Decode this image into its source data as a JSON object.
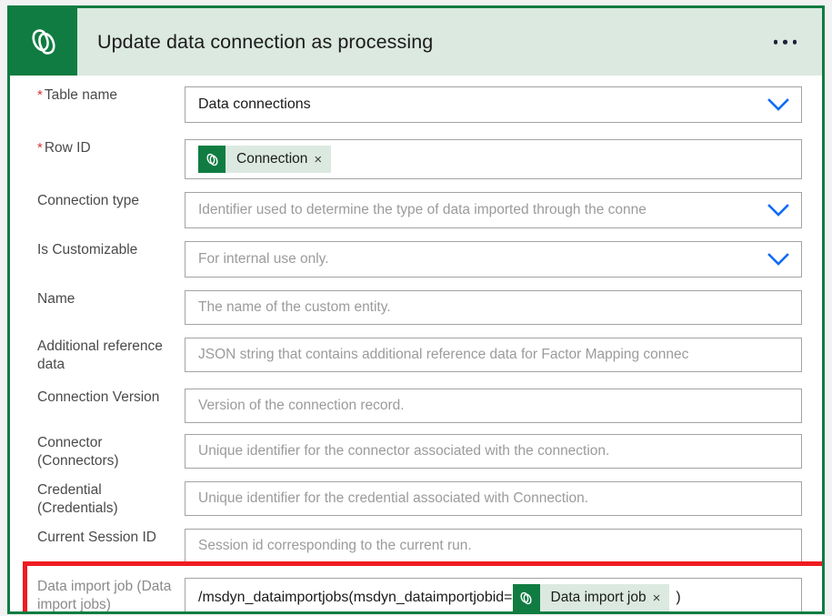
{
  "header": {
    "title": "Update data connection as processing",
    "icon": "dataverse-icon",
    "overflow_label": "...",
    "background_color": "#dbe9e0",
    "icon_tile_color": "#107c41"
  },
  "colors": {
    "accent_green": "#107c41",
    "chip_background": "#dbe9e0",
    "required_red": "#d13438",
    "highlight_red": "#ee1c21",
    "chevron_blue": "#0f6cf5"
  },
  "fields": [
    {
      "label": "Table name",
      "required": true,
      "value": "Data connections",
      "has_dropdown": true
    },
    {
      "label": "Row ID",
      "required": true,
      "token": {
        "label": "Connection",
        "icon": "dataverse-icon",
        "close": "×"
      },
      "has_dropdown": false
    },
    {
      "label": "Connection type",
      "required": false,
      "placeholder": "Identifier used to determine the type of data imported through the conne",
      "has_dropdown": true
    },
    {
      "label": "Is Customizable",
      "required": false,
      "placeholder": "For internal use only.",
      "has_dropdown": true
    },
    {
      "label": "Name",
      "required": false,
      "placeholder": "The name of the custom entity.",
      "has_dropdown": false
    },
    {
      "label": "Additional reference\ndata",
      "required": false,
      "placeholder": "JSON string that contains additional reference data for Factor Mapping connec",
      "has_dropdown": false
    },
    {
      "label": "Connection Version",
      "required": false,
      "placeholder": "Version of the connection record.",
      "has_dropdown": false
    },
    {
      "label": "Connector (Connectors)",
      "required": false,
      "placeholder": "Unique identifier for the connector associated with the connection.",
      "has_dropdown": false
    },
    {
      "label": "Credential (Credentials)",
      "required": false,
      "placeholder": "Unique identifier for the credential associated with Connection.",
      "has_dropdown": false
    },
    {
      "label": "Current Session ID",
      "required": false,
      "placeholder": "Session id corresponding to the current run.",
      "has_dropdown": false
    },
    {
      "label": "Data import job (Data\nimport jobs)",
      "required": false,
      "dim_label": true,
      "expression_prefix": "/msdyn_dataimportjobs(msdyn_dataimportjobid=",
      "token": {
        "label": "Data import job",
        "icon": "dataverse-icon",
        "close": "×"
      },
      "expression_suffix": ")",
      "highlighted": true,
      "has_dropdown": false
    }
  ]
}
